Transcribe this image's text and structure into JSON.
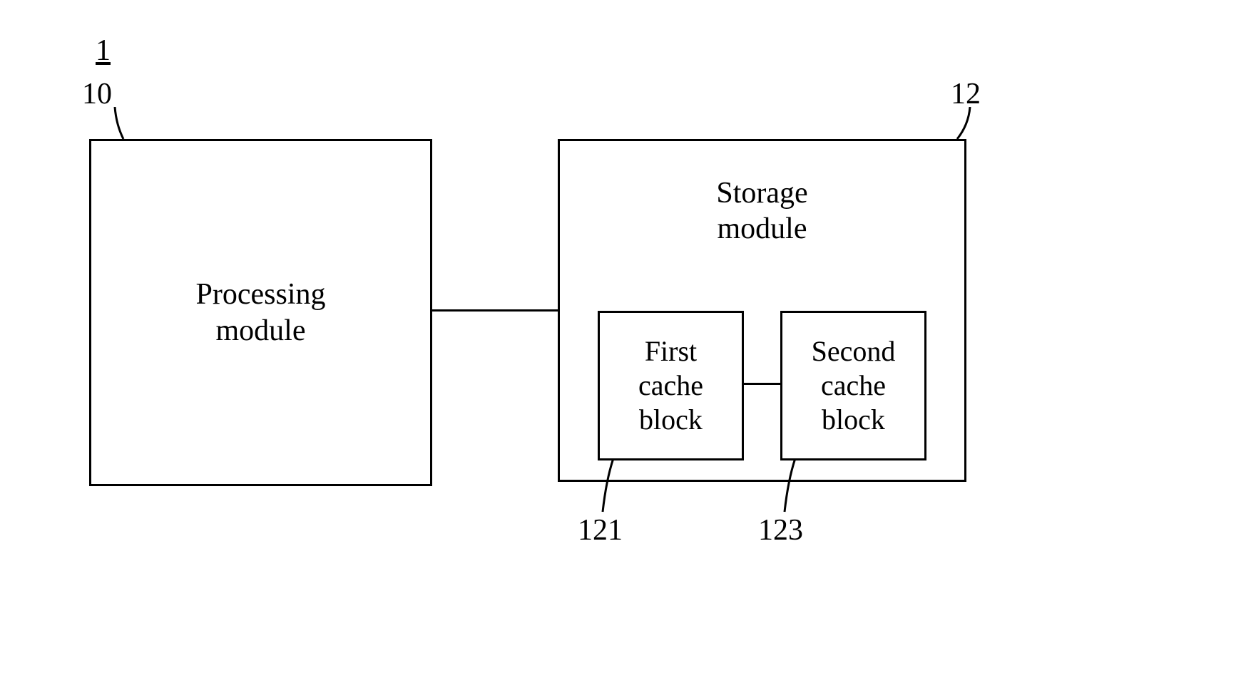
{
  "labels": {
    "system": "1",
    "processing": "10",
    "storage": "12",
    "firstCache": "121",
    "secondCache": "123"
  },
  "boxes": {
    "processing": "Processing\nmodule",
    "storage": "Storage\nmodule",
    "firstCache": "First\ncache\nblock",
    "secondCache": "Second\ncache\nblock"
  }
}
